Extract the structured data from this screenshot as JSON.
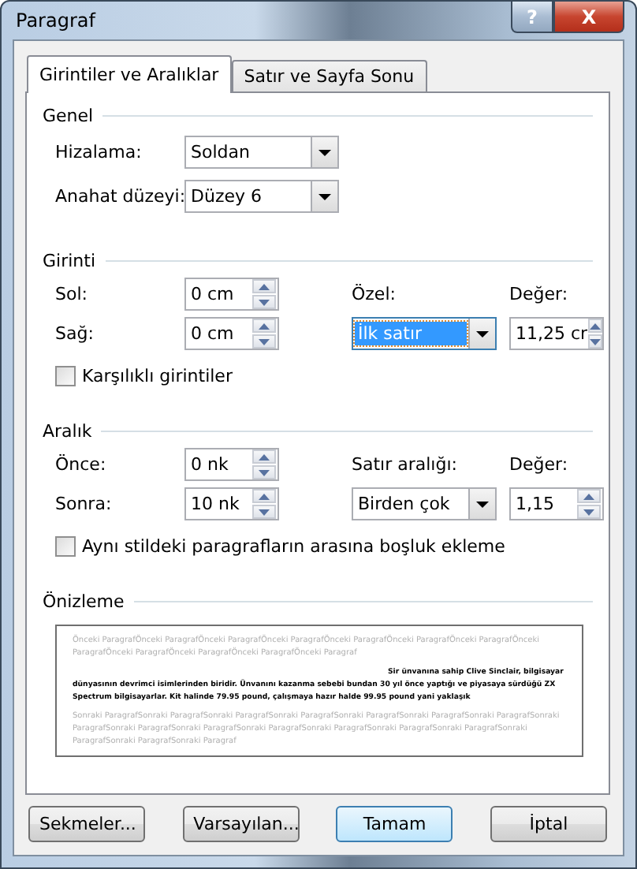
{
  "window": {
    "title": "Paragraf"
  },
  "title_buttons": [
    {
      "kind": "help",
      "label": "?"
    },
    {
      "kind": "close",
      "label": "X"
    }
  ],
  "tabs": [
    {
      "label": "Girintiler ve Aralıklar",
      "selected": true
    },
    {
      "label": "Satır ve Sayfa Sonu",
      "selected": false
    }
  ],
  "general": {
    "title": "Genel",
    "fields": [
      {
        "label": "Hizalama:",
        "value": "Soldan"
      },
      {
        "label": "Anahat düzeyi:",
        "value": "Düzey 6"
      }
    ]
  },
  "indent": {
    "title": "Girinti",
    "left": {
      "label": "Sol:",
      "value": "0 cm"
    },
    "right": {
      "label": "Sağ:",
      "value": "0 cm"
    },
    "special": {
      "label": "Özel:",
      "value": "İlk satır",
      "focused": true
    },
    "by": {
      "label": "Değer:",
      "value": "11,25 cr"
    },
    "mirror": {
      "label": "Karşılıklı girintiler",
      "checked": false
    }
  },
  "spacing": {
    "title": "Aralık",
    "before": {
      "label": "Önce:",
      "value": "0 nk"
    },
    "after": {
      "label": "Sonra:",
      "value": "10 nk"
    },
    "line": {
      "label": "Satır aralığı:",
      "value": "Birden çok",
      "focused": false
    },
    "at": {
      "label": "Değer:",
      "value": "1,15"
    },
    "no_space": {
      "label": "Aynı stildeki paragrafların arasına boşluk ekleme",
      "checked": false
    }
  },
  "preview": {
    "title": "Önizleme",
    "previous": "Önceki ParagrafÖnceki ParagrafÖnceki ParagrafÖnceki ParagrafÖnceki ParagrafÖnceki ParagrafÖnceki ParagrafÖnceki ParagrafÖnceki ParagrafÖnceki ParagrafÖnceki ParagrafÖnceki Paragraf",
    "current": "Sir ünvanına sahip Clive Sinclair, bilgisayar dünyasının devrimci isimlerinden biridir. Ünvanını kazanma sebebi bundan 30 yıl önce yaptığı ve piyasaya sürdüğü ZX Spectrum bilgisayarlar. Kit halinde 79.95 pound, çalışmaya hazır halde 99.95 pound yani yaklaşık",
    "next": "Sonraki ParagrafSonraki ParagrafSonraki ParagrafSonraki ParagrafSonraki ParagrafSonraki ParagrafSonraki ParagrafSonraki ParagrafSonraki ParagrafSonraki ParagrafSonraki ParagrafSonraki ParagrafSonraki ParagrafSonraki ParagrafSonraki ParagrafSonraki ParagrafSonraki Paragraf"
  },
  "buttons": [
    {
      "label": "Sekmeler...",
      "default": false
    },
    {
      "label": "Varsayılan...",
      "default": false
    },
    {
      "label": "Tamam",
      "default": true
    },
    {
      "label": "İptal",
      "default": false
    }
  ]
}
